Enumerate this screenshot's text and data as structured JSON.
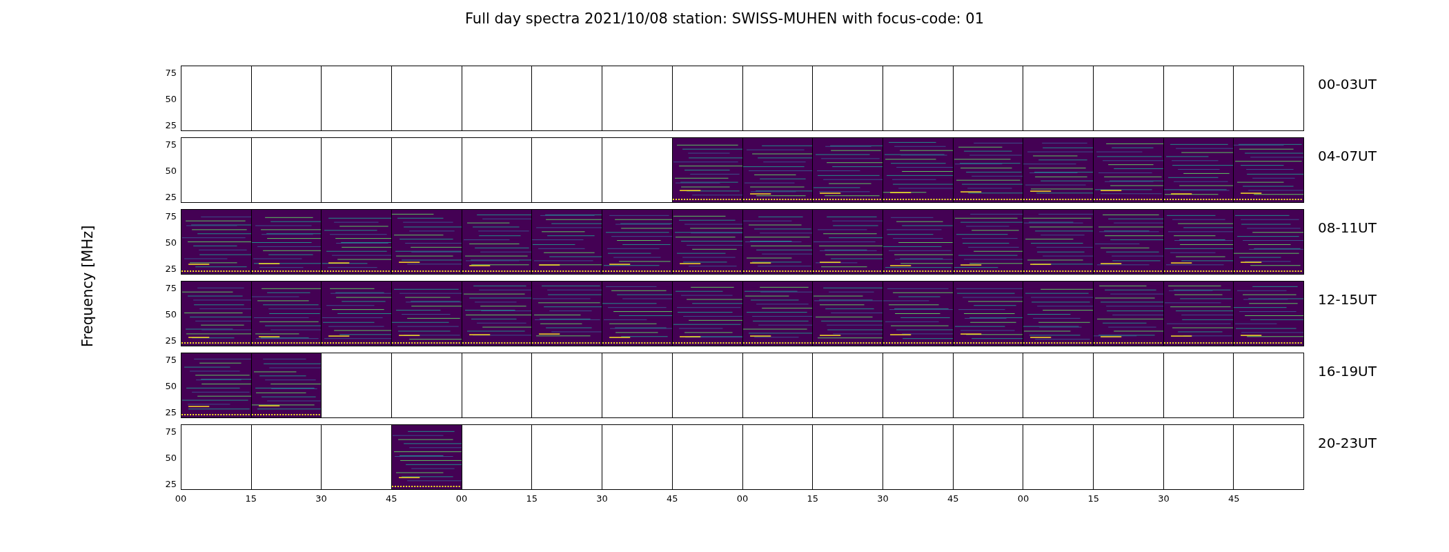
{
  "title": "Full day spectra 2021/10/08 station: SWISS-MUHEN with focus-code: 01",
  "ylabel": "Frequency [MHz]",
  "xticks": [
    "00",
    "15",
    "30",
    "45",
    "00",
    "15",
    "30",
    "45",
    "00",
    "15",
    "30",
    "45",
    "00",
    "15",
    "30",
    "45"
  ],
  "rows": [
    {
      "label": "00-03UT",
      "yticks": [
        "75",
        "50",
        "25"
      ],
      "panels": [
        {
          "filled": false
        },
        {
          "filled": false
        },
        {
          "filled": false
        },
        {
          "filled": false
        },
        {
          "filled": false
        },
        {
          "filled": false
        },
        {
          "filled": false
        },
        {
          "filled": false
        },
        {
          "filled": false
        },
        {
          "filled": false
        },
        {
          "filled": false
        },
        {
          "filled": false
        },
        {
          "filled": false
        },
        {
          "filled": false
        },
        {
          "filled": false
        },
        {
          "filled": false
        }
      ]
    },
    {
      "label": "04-07UT",
      "yticks": [
        "75",
        "50",
        "25"
      ],
      "panels": [
        {
          "filled": false
        },
        {
          "filled": false
        },
        {
          "filled": false
        },
        {
          "filled": false
        },
        {
          "filled": false
        },
        {
          "filled": false
        },
        {
          "filled": false
        },
        {
          "filled": true
        },
        {
          "filled": true
        },
        {
          "filled": true
        },
        {
          "filled": true
        },
        {
          "filled": true
        },
        {
          "filled": true
        },
        {
          "filled": true
        },
        {
          "filled": true
        },
        {
          "filled": true
        }
      ]
    },
    {
      "label": "08-11UT",
      "yticks": [
        "75",
        "50",
        "25"
      ],
      "panels": [
        {
          "filled": true
        },
        {
          "filled": true
        },
        {
          "filled": true
        },
        {
          "filled": true
        },
        {
          "filled": true
        },
        {
          "filled": true
        },
        {
          "filled": true
        },
        {
          "filled": true
        },
        {
          "filled": true
        },
        {
          "filled": true
        },
        {
          "filled": true
        },
        {
          "filled": true
        },
        {
          "filled": true
        },
        {
          "filled": true
        },
        {
          "filled": true
        },
        {
          "filled": true
        }
      ]
    },
    {
      "label": "12-15UT",
      "yticks": [
        "75",
        "50",
        "25"
      ],
      "panels": [
        {
          "filled": true
        },
        {
          "filled": true
        },
        {
          "filled": true
        },
        {
          "filled": true
        },
        {
          "filled": true
        },
        {
          "filled": true
        },
        {
          "filled": true
        },
        {
          "filled": true
        },
        {
          "filled": true
        },
        {
          "filled": true
        },
        {
          "filled": true
        },
        {
          "filled": true
        },
        {
          "filled": true
        },
        {
          "filled": true
        },
        {
          "filled": true
        },
        {
          "filled": true
        }
      ]
    },
    {
      "label": "16-19UT",
      "yticks": [
        "75",
        "50",
        "25"
      ],
      "panels": [
        {
          "filled": true
        },
        {
          "filled": true
        },
        {
          "filled": false
        },
        {
          "filled": false
        },
        {
          "filled": false
        },
        {
          "filled": false
        },
        {
          "filled": false
        },
        {
          "filled": false
        },
        {
          "filled": false
        },
        {
          "filled": false
        },
        {
          "filled": false
        },
        {
          "filled": false
        },
        {
          "filled": false
        },
        {
          "filled": false
        },
        {
          "filled": false
        },
        {
          "filled": false
        }
      ]
    },
    {
      "label": "20-23UT",
      "yticks": [
        "75",
        "50",
        "25"
      ],
      "panels": [
        {
          "filled": false
        },
        {
          "filled": false
        },
        {
          "filled": false
        },
        {
          "filled": true
        },
        {
          "filled": false
        },
        {
          "filled": false
        },
        {
          "filled": false
        },
        {
          "filled": false
        },
        {
          "filled": false
        },
        {
          "filled": false
        },
        {
          "filled": false
        },
        {
          "filled": false
        },
        {
          "filled": false
        },
        {
          "filled": false
        },
        {
          "filled": false
        },
        {
          "filled": false
        }
      ]
    }
  ]
}
